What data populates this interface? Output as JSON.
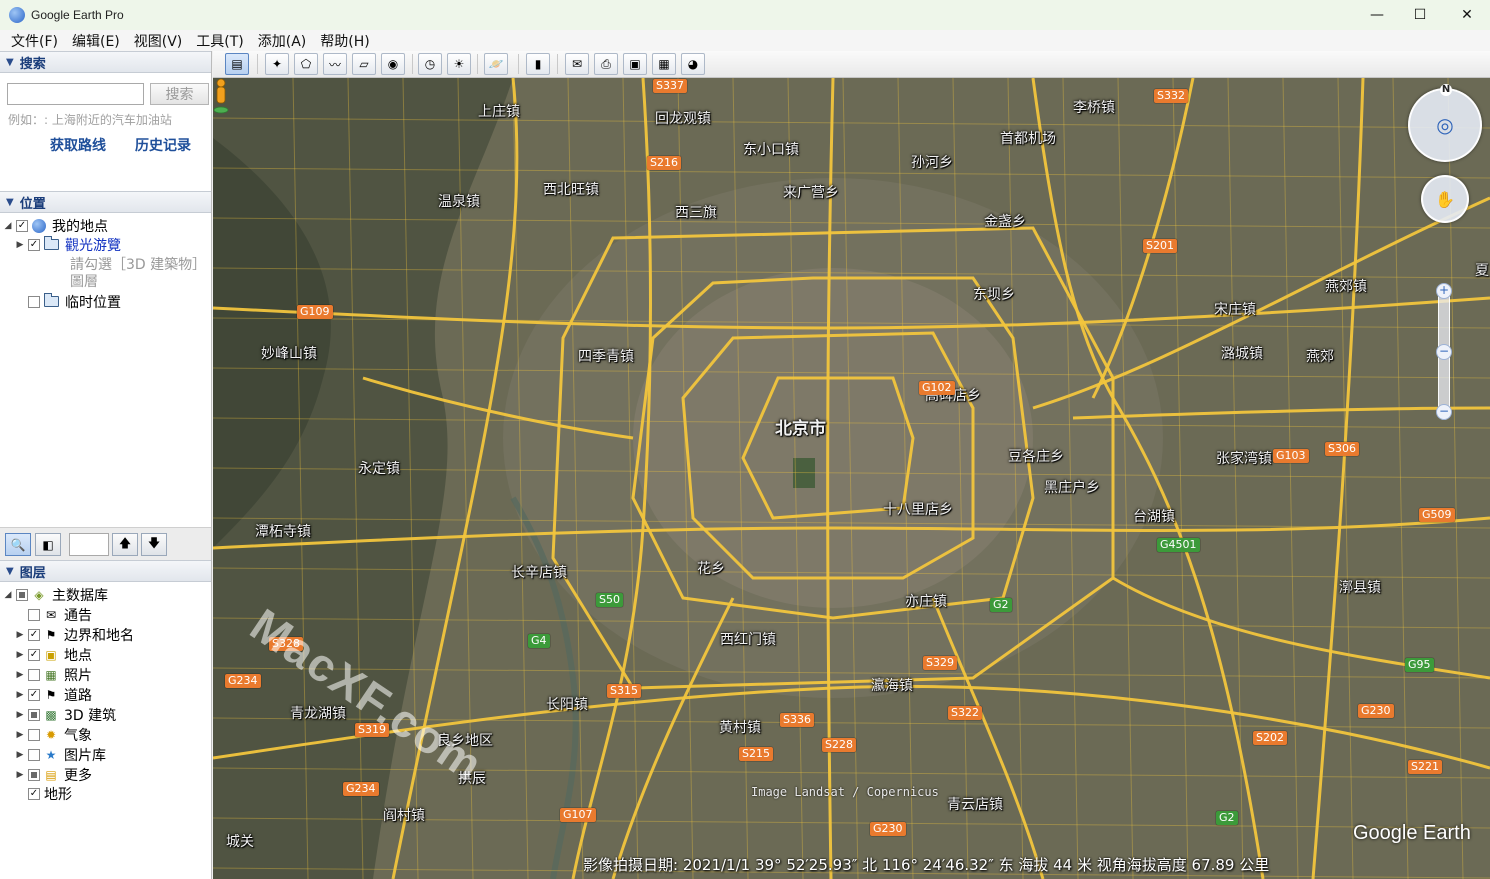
{
  "window": {
    "title": "Google Earth Pro",
    "minimize": "—",
    "maximize": "☐",
    "close": "✕"
  },
  "menu": [
    "文件(F)",
    "编辑(E)",
    "视图(V)",
    "工具(T)",
    "添加(A)",
    "帮助(H)"
  ],
  "search": {
    "header": "搜索",
    "value": "",
    "button": "搜索",
    "hint": "例如：: 上海附近的汽车加油站",
    "get_directions": "获取路线",
    "history": "历史记录"
  },
  "places": {
    "header": "位置",
    "items": [
      {
        "label": "我的地点",
        "checked": true
      },
      {
        "label": "觀光游覽",
        "checked": true
      },
      {
        "label": "請勾選［3D 建築物］",
        "checked": null
      },
      {
        "label": "圖層",
        "checked": null
      },
      {
        "label": "临时位置",
        "checked": false
      }
    ]
  },
  "layers": {
    "header": "图层",
    "items": [
      {
        "label": "主数据库",
        "state": "partial"
      },
      {
        "label": "通告",
        "state": "unchecked"
      },
      {
        "label": "边界和地名",
        "state": "checked"
      },
      {
        "label": "地点",
        "state": "checked"
      },
      {
        "label": "照片",
        "state": "unchecked"
      },
      {
        "label": "道路",
        "state": "checked"
      },
      {
        "label": "3D 建筑",
        "state": "partial"
      },
      {
        "label": "气象",
        "state": "unchecked"
      },
      {
        "label": "图片库",
        "state": "unchecked"
      },
      {
        "label": "更多",
        "state": "partial"
      },
      {
        "label": "地形",
        "state": "checked"
      }
    ]
  },
  "map": {
    "labels": [
      {
        "t": "上庄镇"
      },
      {
        "t": "回龙观镇"
      },
      {
        "t": "东小口镇"
      },
      {
        "t": "首都机场"
      },
      {
        "t": "李桥镇"
      },
      {
        "t": "温泉镇"
      },
      {
        "t": "西北旺镇"
      },
      {
        "t": "西三旗"
      },
      {
        "t": "来广营乡"
      },
      {
        "t": "孙河乡"
      },
      {
        "t": "金盏乡"
      },
      {
        "t": "东坝乡"
      },
      {
        "t": "燕郊镇"
      },
      {
        "t": "宋庄镇"
      },
      {
        "t": "妙峰山镇"
      },
      {
        "t": "四季青镇"
      },
      {
        "t": "潞城镇"
      },
      {
        "t": "燕郊"
      },
      {
        "t": "高碑店乡"
      },
      {
        "t": "北京市",
        "big": true
      },
      {
        "t": "永定镇"
      },
      {
        "t": "豆各庄乡"
      },
      {
        "t": "张家湾镇"
      },
      {
        "t": "黑庄户乡"
      },
      {
        "t": "十八里店乡"
      },
      {
        "t": "潭柘寺镇"
      },
      {
        "t": "台湖镇"
      },
      {
        "t": "长辛店镇"
      },
      {
        "t": "花乡"
      },
      {
        "t": "亦庄镇"
      },
      {
        "t": "漷县镇"
      },
      {
        "t": "西红门镇"
      },
      {
        "t": "长阳镇"
      },
      {
        "t": "瀛海镇"
      },
      {
        "t": "青龙湖镇"
      },
      {
        "t": "黄村镇"
      },
      {
        "t": "良乡地区"
      },
      {
        "t": "拱辰"
      },
      {
        "t": "阎村镇"
      },
      {
        "t": "青云店镇"
      },
      {
        "t": "城关"
      },
      {
        "t": "夏"
      }
    ],
    "shields": [
      {
        "t": "S337"
      },
      {
        "t": "S332"
      },
      {
        "t": "S216"
      },
      {
        "t": "S201"
      },
      {
        "t": "G109"
      },
      {
        "t": "G102"
      },
      {
        "t": "G103"
      },
      {
        "t": "S306"
      },
      {
        "t": "G509"
      },
      {
        "t": "G4501",
        "green": true
      },
      {
        "t": "S50",
        "green": true
      },
      {
        "t": "G2",
        "green": true
      },
      {
        "t": "S328"
      },
      {
        "t": "G4",
        "green": true
      },
      {
        "t": "G95",
        "green": true
      },
      {
        "t": "G234"
      },
      {
        "t": "S315"
      },
      {
        "t": "S329"
      },
      {
        "t": "S322"
      },
      {
        "t": "G230"
      },
      {
        "t": "S319"
      },
      {
        "t": "S336"
      },
      {
        "t": "S228"
      },
      {
        "t": "S202"
      },
      {
        "t": "S215"
      },
      {
        "t": "S221"
      },
      {
        "t": "G234"
      },
      {
        "t": "G107"
      },
      {
        "t": "G230"
      },
      {
        "t": "G2",
        "green": true
      }
    ],
    "credit": "Image Landsat / Copernicus",
    "logo": "Google Earth",
    "status": "影像拍摄日期: 2021/1/1   39° 52′25.93″ 北 116° 24′46.32″ 东 海拔    44 米   视角海拔高度  67.89 公里",
    "compass_north": "N",
    "watermark": [
      "MacXF.com"
    ]
  },
  "colors": {
    "road": "#f2c53d",
    "accent": "#1f4f9a",
    "shield": "#e97a2e",
    "shield_green": "#3c9a3a"
  }
}
